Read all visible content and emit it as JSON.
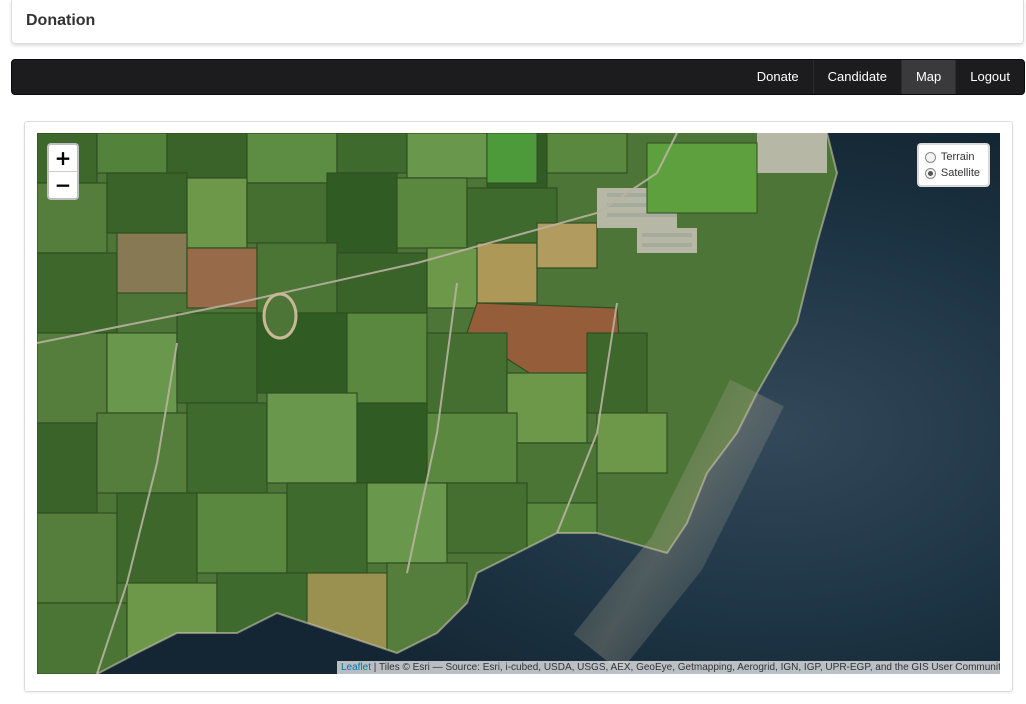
{
  "header": {
    "title": "Donation"
  },
  "nav": {
    "items": [
      {
        "label": "Donate",
        "active": false
      },
      {
        "label": "Candidate",
        "active": false
      },
      {
        "label": "Map",
        "active": true
      },
      {
        "label": "Logout",
        "active": false
      }
    ]
  },
  "map": {
    "zoom_in": "+",
    "zoom_out": "−",
    "layers": [
      {
        "label": "Terrain",
        "checked": false
      },
      {
        "label": "Satellite",
        "checked": true
      }
    ],
    "attribution": {
      "link": "Leaflet",
      "text": " | Tiles © Esri — Source: Esri, i-cubed, USDA, USGS, AEX, GeoEye, Getmapping, Aerogrid, IGN, IGP, UPR-EGP, and the GIS User Community"
    }
  },
  "colors": {
    "navbar_bg": "#1c1c1e",
    "nav_active_bg": "#3a3a3c",
    "field_green_dark": "#3f6a2e",
    "field_green_light": "#6f9a4c",
    "sea": "#1d3444",
    "attribution_link": "#0078a8"
  }
}
